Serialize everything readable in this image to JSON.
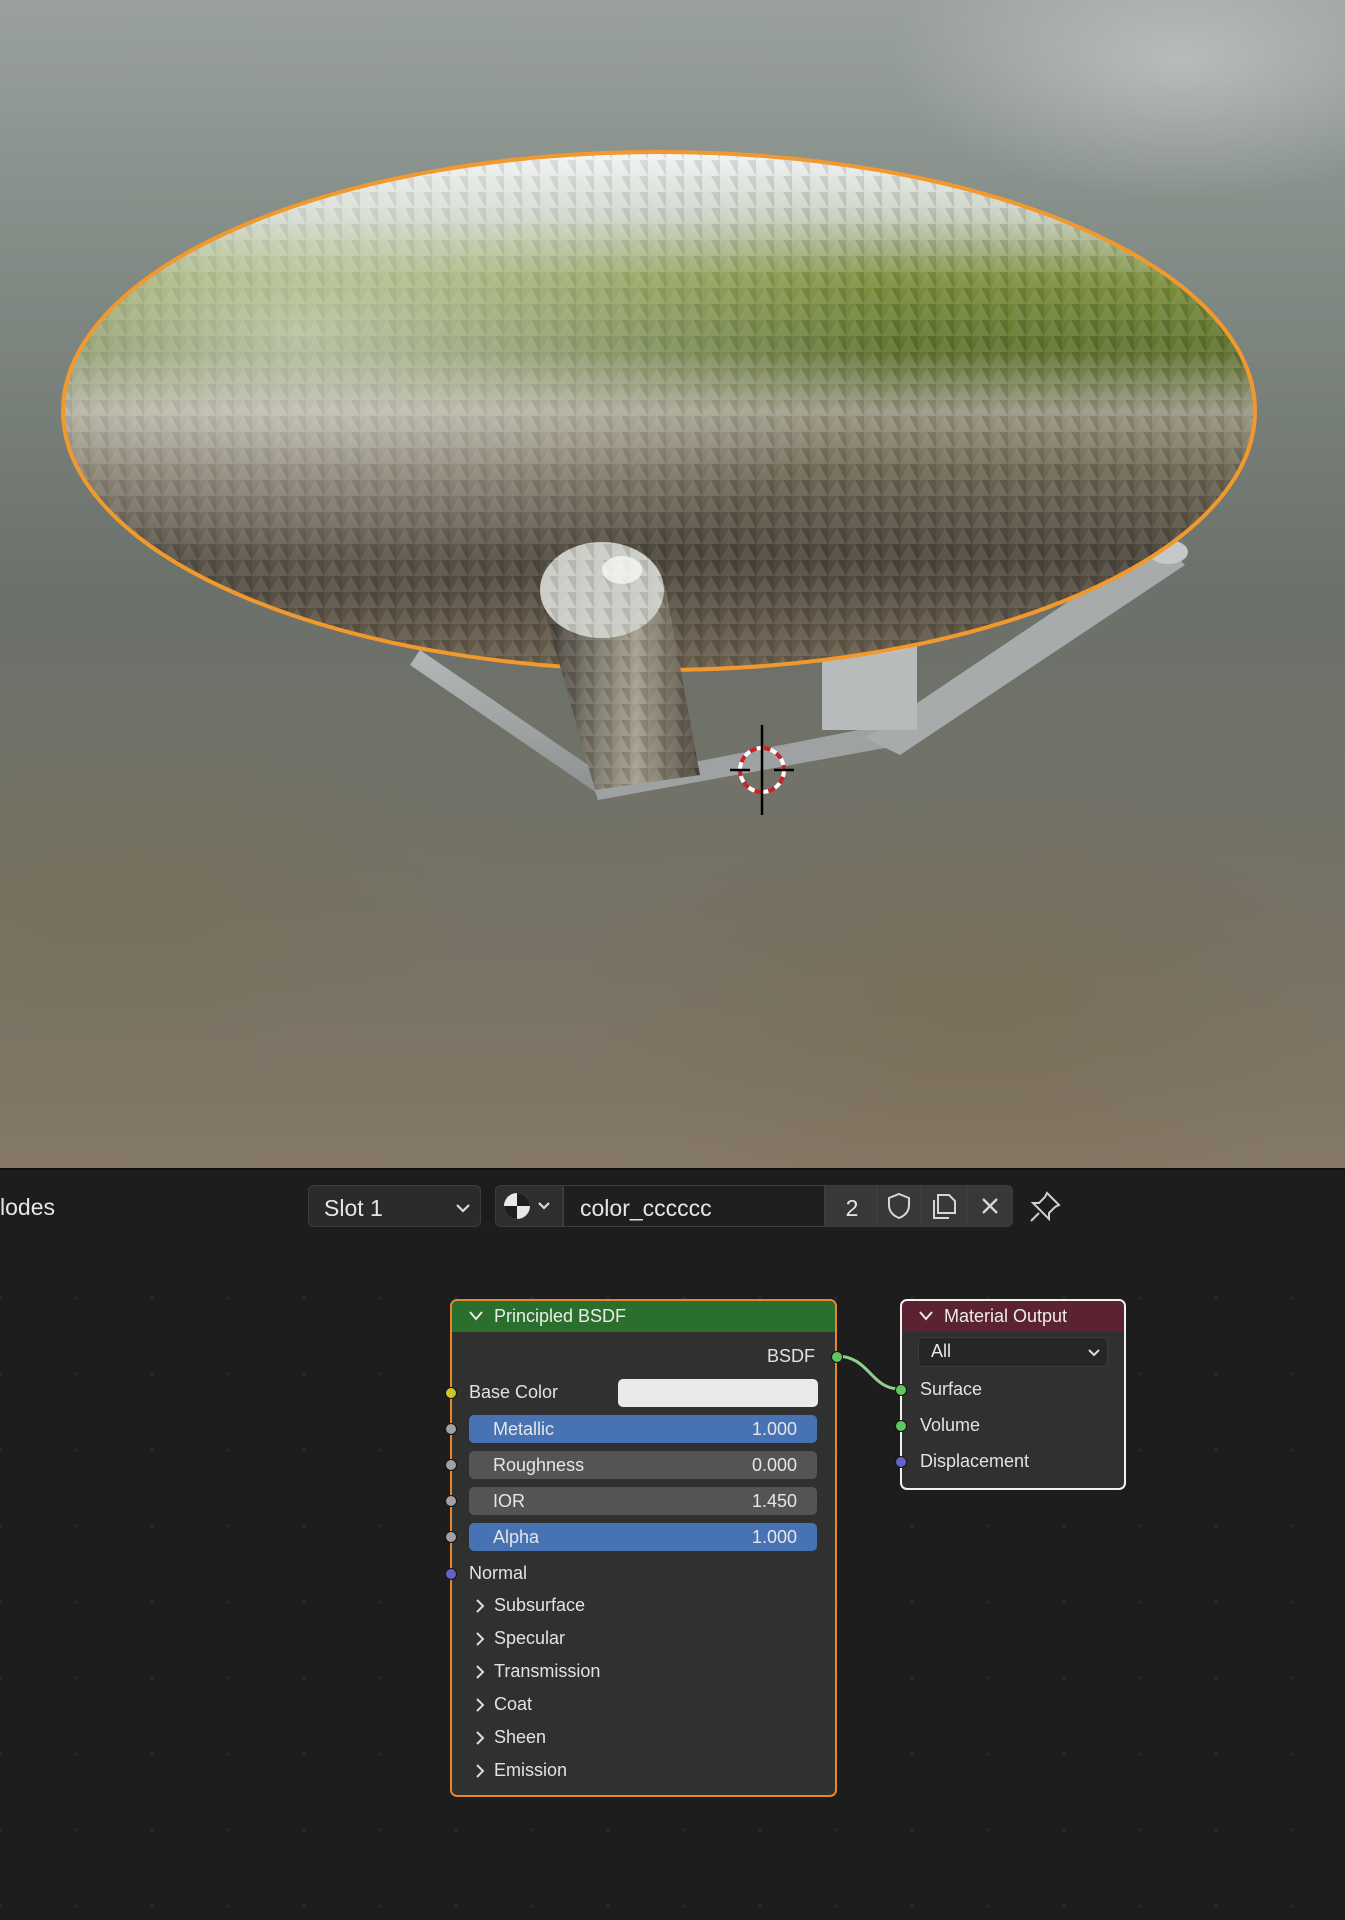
{
  "viewport": {
    "selection_outline_color": "#f2992e",
    "cursor_icon": "3d-cursor-icon"
  },
  "header": {
    "editor_label": "lodes",
    "slot_label": "Slot 1",
    "material_browse_icon": "material-sphere-icon",
    "material_name": "color_cccccc",
    "user_count": "2",
    "fake_user_icon": "shield-icon",
    "duplicate_icon": "duplicate-icon",
    "unlink_icon": "close-icon",
    "pin_icon": "pin-icon"
  },
  "nodes": {
    "principled": {
      "title": "Principled BSDF",
      "output_label": "BSDF",
      "base_color_label": "Base Color",
      "base_color_value": "#eaeaea",
      "fields": [
        {
          "label": "Metallic",
          "value": "1.000",
          "highlight": true
        },
        {
          "label": "Roughness",
          "value": "0.000",
          "highlight": false
        },
        {
          "label": "IOR",
          "value": "1.450",
          "highlight": false
        },
        {
          "label": "Alpha",
          "value": "1.000",
          "highlight": true
        }
      ],
      "normal_label": "Normal",
      "panels": [
        "Subsurface",
        "Specular",
        "Transmission",
        "Coat",
        "Sheen",
        "Emission"
      ],
      "header_color": "#2a6f2b",
      "selected_outline": "#e8862b"
    },
    "output": {
      "title": "Material Output",
      "target": "All",
      "inputs": [
        "Surface",
        "Volume",
        "Displacement"
      ],
      "header_color": "#5b2232"
    }
  },
  "colors": {
    "socket_shader": "#5fc75f",
    "socket_color": "#c7c729",
    "socket_float": "#a1a1a1",
    "socket_vector": "#6363c7",
    "field_highlight": "#4772b3"
  }
}
